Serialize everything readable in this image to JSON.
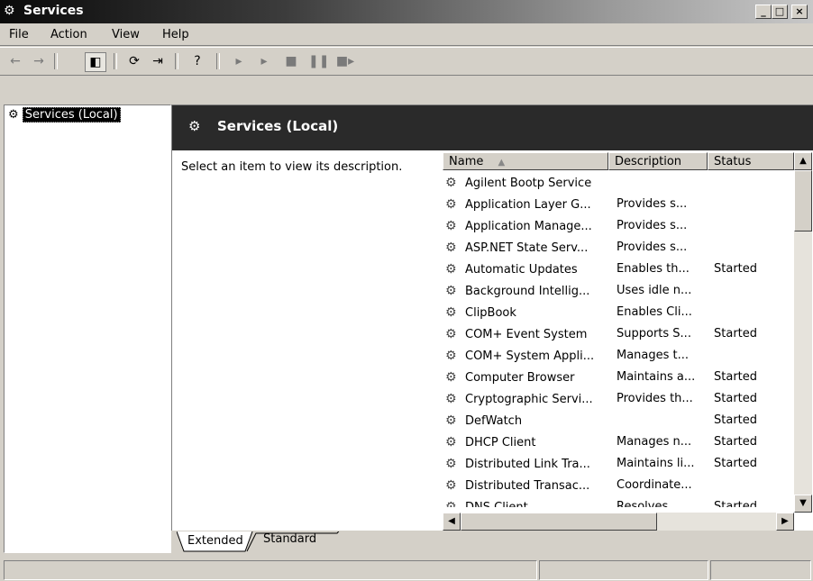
{
  "window": {
    "title": "Services",
    "icon": "services-gears-icon",
    "controls": {
      "minimize": "_",
      "maximize": "□",
      "close": "×"
    }
  },
  "menu": [
    {
      "label": "File",
      "accel": "F"
    },
    {
      "label": "Action",
      "accel": "A"
    },
    {
      "label": "View",
      "accel": "V"
    },
    {
      "label": "Help",
      "accel": "H"
    }
  ],
  "toolbar": {
    "buttons": [
      "back-icon",
      "forward-icon",
      "show-hide-console-tree-icon",
      "refresh-icon",
      "export-list-icon",
      "help-icon",
      "start-service-icon",
      "start-service-icon",
      "stop-service-icon",
      "pause-service-icon",
      "restart-service-icon"
    ]
  },
  "tree": {
    "root_label": "Services (Local)"
  },
  "header": {
    "title": "Services (Local)"
  },
  "description_text": "Select an item to view its description.",
  "list": {
    "columns": [
      {
        "label": "Name",
        "sort": "▲"
      },
      {
        "label": "Description"
      },
      {
        "label": "Status"
      }
    ],
    "rows": [
      {
        "name": "Agilent Bootp Service",
        "description": "",
        "status": ""
      },
      {
        "name": "Application Layer G...",
        "description": "Provides s...",
        "status": ""
      },
      {
        "name": "Application Manage...",
        "description": "Provides s...",
        "status": ""
      },
      {
        "name": "ASP.NET State Serv...",
        "description": "Provides s...",
        "status": ""
      },
      {
        "name": "Automatic Updates",
        "description": "Enables th...",
        "status": "Started"
      },
      {
        "name": "Background Intellig...",
        "description": "Uses idle n...",
        "status": ""
      },
      {
        "name": "ClipBook",
        "description": "Enables Cli...",
        "status": ""
      },
      {
        "name": "COM+ Event System",
        "description": "Supports S...",
        "status": "Started"
      },
      {
        "name": "COM+ System Appli...",
        "description": "Manages t...",
        "status": ""
      },
      {
        "name": "Computer Browser",
        "description": "Maintains a...",
        "status": "Started"
      },
      {
        "name": "Cryptographic Servi...",
        "description": "Provides th...",
        "status": "Started"
      },
      {
        "name": "DefWatch",
        "description": "",
        "status": "Started"
      },
      {
        "name": "DHCP Client",
        "description": "Manages n...",
        "status": "Started"
      },
      {
        "name": "Distributed Link Tra...",
        "description": "Maintains li...",
        "status": "Started"
      },
      {
        "name": "Distributed Transac...",
        "description": "Coordinate...",
        "status": ""
      },
      {
        "name": "DNS Client",
        "description": "Resolves ...",
        "status": "Started"
      }
    ]
  },
  "tabs": [
    {
      "label": "Extended",
      "active": true
    },
    {
      "label": "Standard",
      "active": false
    }
  ]
}
